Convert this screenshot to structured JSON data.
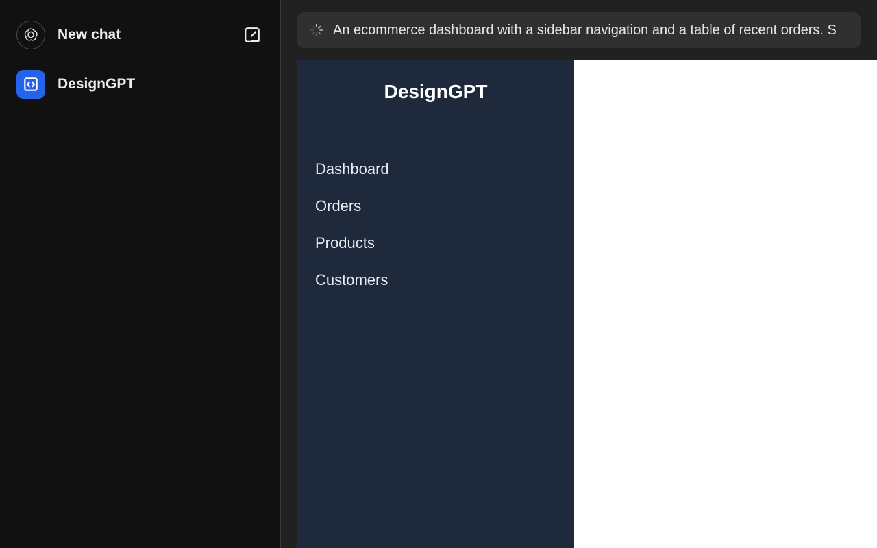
{
  "chat_sidebar": {
    "new_chat_label": "New chat",
    "items": [
      {
        "label": "DesignGPT"
      }
    ]
  },
  "prompt": {
    "text": "An ecommerce dashboard with a sidebar navigation and a table of recent orders. S"
  },
  "preview": {
    "brand": "DesignGPT",
    "nav": [
      {
        "label": "Dashboard"
      },
      {
        "label": "Orders"
      },
      {
        "label": "Products"
      },
      {
        "label": "Customers"
      }
    ]
  }
}
